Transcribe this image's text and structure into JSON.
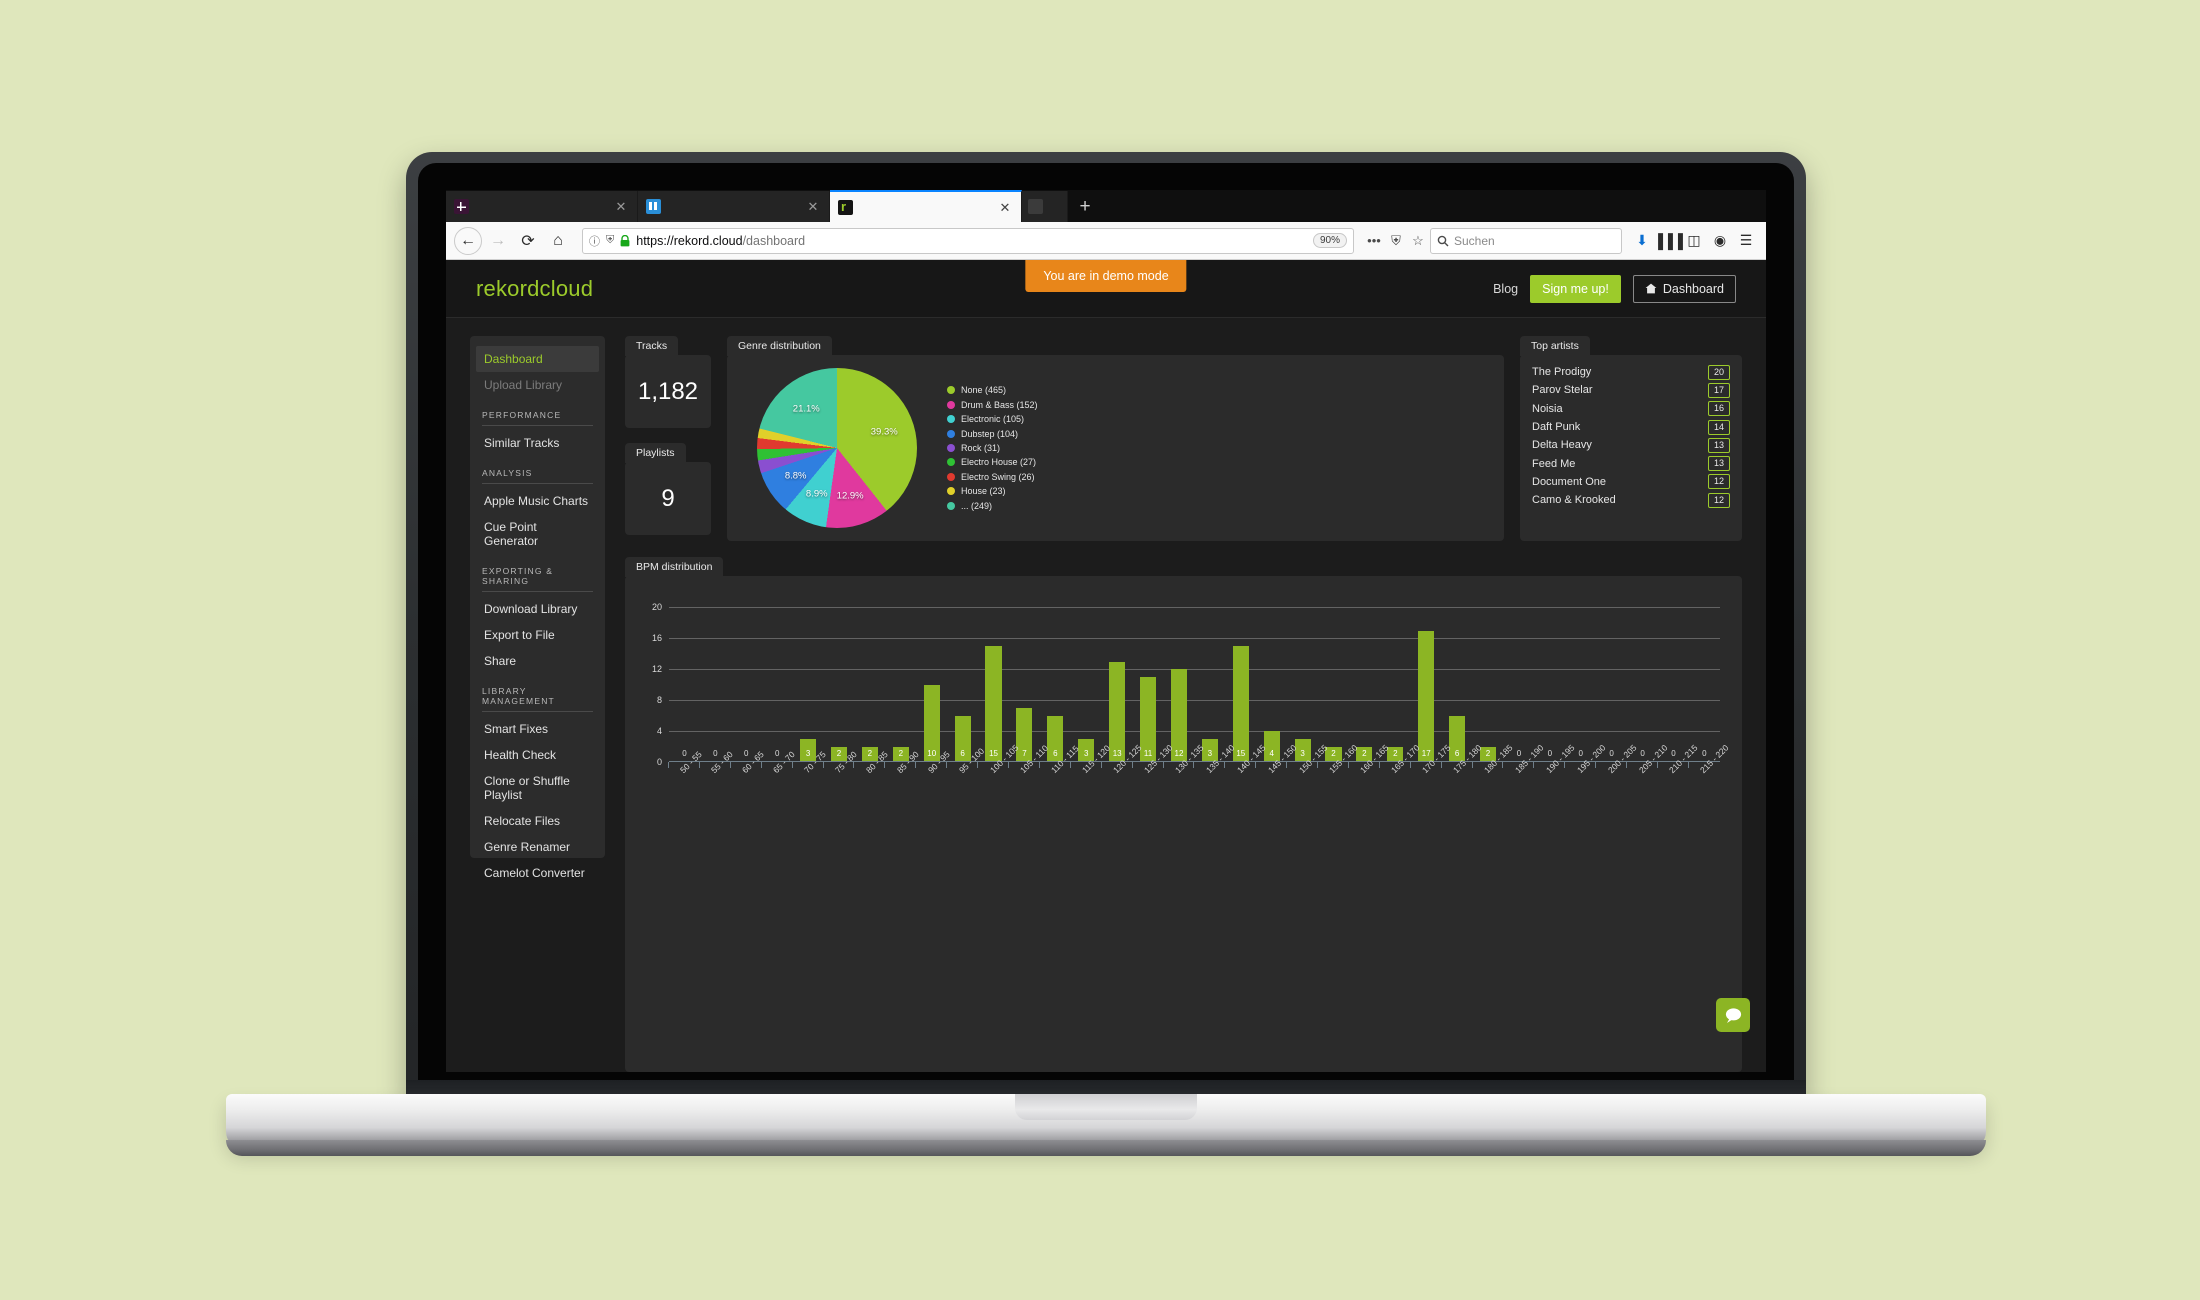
{
  "browser": {
    "tabs": [
      {
        "title": "",
        "favicon": "slack-icon",
        "active": false
      },
      {
        "title": "",
        "favicon": "music-app-icon",
        "active": false
      },
      {
        "title": "",
        "favicon": "rekordcloud-icon",
        "active": true
      },
      {
        "title": "",
        "favicon": "generic-site-icon",
        "active": false
      }
    ],
    "new_tab_label": "+",
    "close_label": "✕",
    "back_label": "←",
    "forward_label": "→",
    "reload_label": "⟳",
    "home_label": "⌂",
    "url_scheme": "https://rekord.cloud",
    "url_path": "/dashboard",
    "zoom_level": "90%",
    "search_placeholder": "Suchen",
    "info_icon": "ⓘ",
    "shield_icon": "⛨",
    "lock_icon": "ὑ2",
    "page_actions_icon": "•••",
    "pocket_icon": "⛨",
    "bookmark_icon": "☆",
    "downloads_icon": "⬇",
    "library_icon": "▐▐▐",
    "sidebar_icon": "◫",
    "account_icon": "◉",
    "menu_icon": "☰"
  },
  "header": {
    "brand": "rekordcloud",
    "demo_banner": "You are in demo mode",
    "blog_label": "Blog",
    "signup_label": "Sign me up!",
    "dashboard_label": "Dashboard",
    "dashboard_icon": "⌂"
  },
  "sidebar": {
    "items": [
      {
        "label": "Dashboard",
        "state": "active"
      },
      {
        "label": "Upload Library",
        "state": "muted"
      },
      {
        "label": "PERFORMANCE",
        "state": "group"
      },
      {
        "label": "Similar Tracks",
        "state": "normal"
      },
      {
        "label": "ANALYSIS",
        "state": "group"
      },
      {
        "label": "Apple Music Charts",
        "state": "normal"
      },
      {
        "label": "Cue Point Generator",
        "state": "normal"
      },
      {
        "label": "EXPORTING & SHARING",
        "state": "group"
      },
      {
        "label": "Download Library",
        "state": "normal"
      },
      {
        "label": "Export to File",
        "state": "normal"
      },
      {
        "label": "Share",
        "state": "normal"
      },
      {
        "label": "LIBRARY MANAGEMENT",
        "state": "group"
      },
      {
        "label": "Smart Fixes",
        "state": "normal"
      },
      {
        "label": "Health Check",
        "state": "normal"
      },
      {
        "label": "Clone or Shuffle Playlist",
        "state": "normal"
      },
      {
        "label": "Relocate Files",
        "state": "normal"
      },
      {
        "label": "Genre Renamer",
        "state": "normal"
      },
      {
        "label": "Camelot Converter",
        "state": "normal"
      }
    ]
  },
  "stats": [
    {
      "label": "Tracks",
      "value": "1,182"
    },
    {
      "label": "Playlists",
      "value": "9"
    }
  ],
  "top_artists": {
    "title": "Top artists",
    "rows": [
      {
        "name": "The Prodigy",
        "count": "20"
      },
      {
        "name": "Parov Stelar",
        "count": "17"
      },
      {
        "name": "Noisia",
        "count": "16"
      },
      {
        "name": "Daft Punk",
        "count": "14"
      },
      {
        "name": "Delta Heavy",
        "count": "13"
      },
      {
        "name": "Feed Me",
        "count": "13"
      },
      {
        "name": "Document One",
        "count": "12"
      },
      {
        "name": "Camo & Krooked",
        "count": "12"
      }
    ]
  },
  "chat": {
    "icon": "speech-bubble-icon"
  },
  "chart_data": [
    {
      "type": "pie",
      "title": "Genre distribution",
      "legend_position": "right",
      "labels": [
        "None",
        "Drum & Bass",
        "Electronic",
        "Dubstep",
        "Rock",
        "Electro House",
        "Electro Swing",
        "House",
        "..."
      ],
      "values": [
        465,
        152,
        105,
        104,
        31,
        27,
        26,
        23,
        249
      ],
      "legend_entries": [
        "None (465)",
        "Drum & Bass (152)",
        "Electronic (105)",
        "Dubstep (104)",
        "Rock (31)",
        "Electro House (27)",
        "Electro Swing (26)",
        "House (23)",
        "... (249)"
      ],
      "colors": [
        "#9ccb2b",
        "#e0399e",
        "#40d0d0",
        "#2f7fe0",
        "#8a4fd0",
        "#2fc134",
        "#e03a2f",
        "#e0d02a",
        "#45c8a0"
      ],
      "slice_labels": [
        {
          "text": "39.3%",
          "value": 39.3
        },
        {
          "text": "12.9%",
          "value": 12.9
        },
        {
          "text": "8.9%",
          "value": 8.9
        },
        {
          "text": "8.8%",
          "value": 8.8
        },
        {
          "text": "21.1%",
          "value": 21.1
        }
      ]
    },
    {
      "type": "bar",
      "title": "BPM distribution",
      "xlabel": "",
      "ylabel": "",
      "ylim": [
        0,
        22
      ],
      "yticks": [
        0,
        4,
        8,
        12,
        16,
        20
      ],
      "grid": true,
      "categories": [
        "50 - 55",
        "55 - 60",
        "60 - 65",
        "65 - 70",
        "70 - 75",
        "75 - 80",
        "80 - 85",
        "85 - 90",
        "90 - 95",
        "95 - 100",
        "100 - 105",
        "105 - 110",
        "110 - 115",
        "115 - 120",
        "120 - 125",
        "125 - 130",
        "130 - 135",
        "135 - 140",
        "140 - 145",
        "145 - 150",
        "150 - 155",
        "155 - 160",
        "160 - 165",
        "165 - 170",
        "170 - 175",
        "175 - 180",
        "180 - 185",
        "185 - 190",
        "190 - 195",
        "195 - 200",
        "200 - 205",
        "205 - 210",
        "210 - 215",
        "215 - 220"
      ],
      "values": [
        0,
        0,
        0,
        0,
        3,
        2,
        2,
        2,
        10,
        6,
        15,
        7,
        6,
        3,
        13,
        11,
        12,
        3,
        15,
        4,
        3,
        2,
        2,
        2,
        17,
        6,
        2,
        0,
        0,
        0,
        0,
        0,
        0,
        0
      ],
      "bar_color": "#8cb524"
    }
  ]
}
